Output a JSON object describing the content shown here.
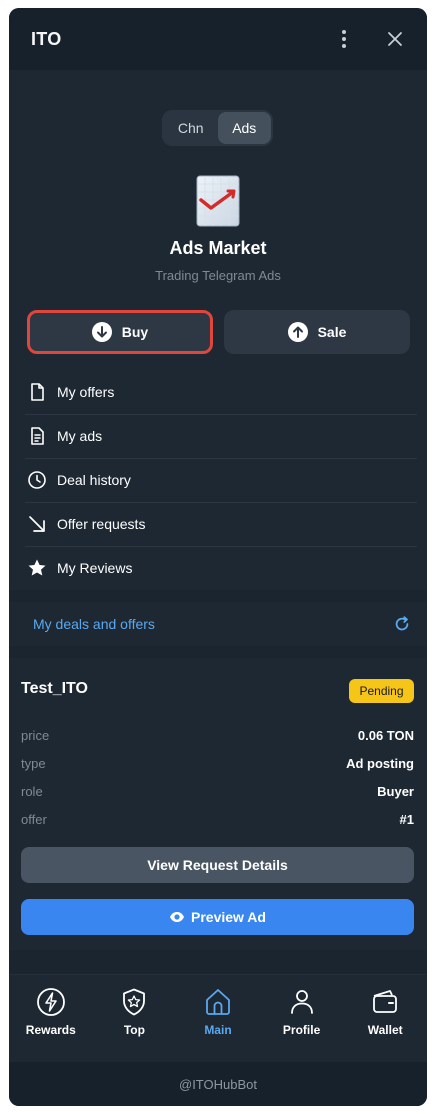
{
  "window": {
    "title": "ITO"
  },
  "segment": {
    "options": [
      "Chn",
      "Ads"
    ],
    "selected": "Ads"
  },
  "app": {
    "name": "Ads Market",
    "subtitle": "Trading Telegram Ads"
  },
  "actions": {
    "buy_label": "Buy",
    "sale_label": "Sale"
  },
  "menu": {
    "items": [
      {
        "label": "My offers",
        "icon": "file-icon"
      },
      {
        "label": "My ads",
        "icon": "document-icon"
      },
      {
        "label": "Deal history",
        "icon": "clock-icon"
      },
      {
        "label": "Offer requests",
        "icon": "arrow-down-right-icon"
      },
      {
        "label": "My Reviews",
        "icon": "star-icon"
      }
    ]
  },
  "deals": {
    "header": "My deals and offers",
    "card": {
      "title": "Test_ITO",
      "status": "Pending",
      "status_color": "#f5c518",
      "fields": [
        {
          "key": "price",
          "value": "0.06 TON"
        },
        {
          "key": "type",
          "value": "Ad posting"
        },
        {
          "key": "role",
          "value": "Buyer"
        },
        {
          "key": "offer",
          "value": "#1"
        }
      ],
      "details_label": "View Request Details",
      "preview_label": "Preview Ad"
    }
  },
  "nav": {
    "items": [
      {
        "label": "Rewards",
        "icon": "lightning-icon"
      },
      {
        "label": "Top",
        "icon": "shield-star-icon"
      },
      {
        "label": "Main",
        "icon": "home-icon",
        "active": true
      },
      {
        "label": "Profile",
        "icon": "user-icon"
      },
      {
        "label": "Wallet",
        "icon": "wallet-icon"
      }
    ]
  },
  "footer": {
    "bot": "@ITOHubBot"
  },
  "colors": {
    "accent": "#5aa8f0",
    "primary_button": "#3a86f0",
    "highlight_border": "#e0463c",
    "background": "#17212b"
  }
}
